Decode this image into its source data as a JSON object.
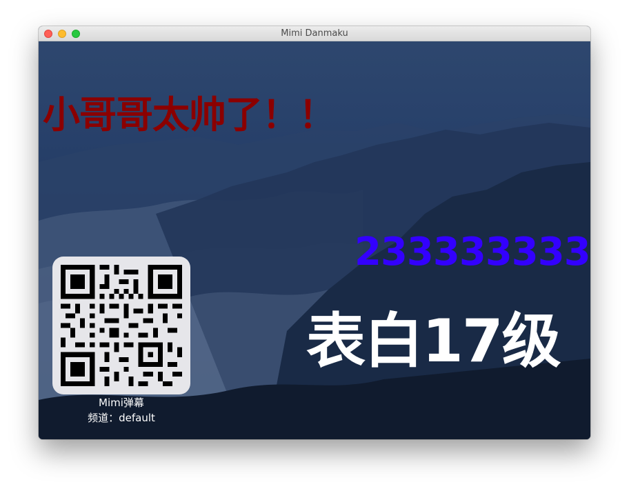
{
  "window": {
    "title": "Mimi Danmaku",
    "controls": [
      "close",
      "minimize",
      "zoom"
    ]
  },
  "danmaku": [
    {
      "text": "小哥哥太帅了！！",
      "color": "#8b0000"
    },
    {
      "text": "233333333",
      "color": "#3300ff"
    },
    {
      "text": "表白17级",
      "color": "#ffffff"
    }
  ],
  "qr": {
    "app_name": "Mimi弹幕",
    "channel_label": "频道：default",
    "icon": "qr-code-icon"
  },
  "background": {
    "description": "mountains-and-clouds",
    "tint": "#23395c"
  }
}
